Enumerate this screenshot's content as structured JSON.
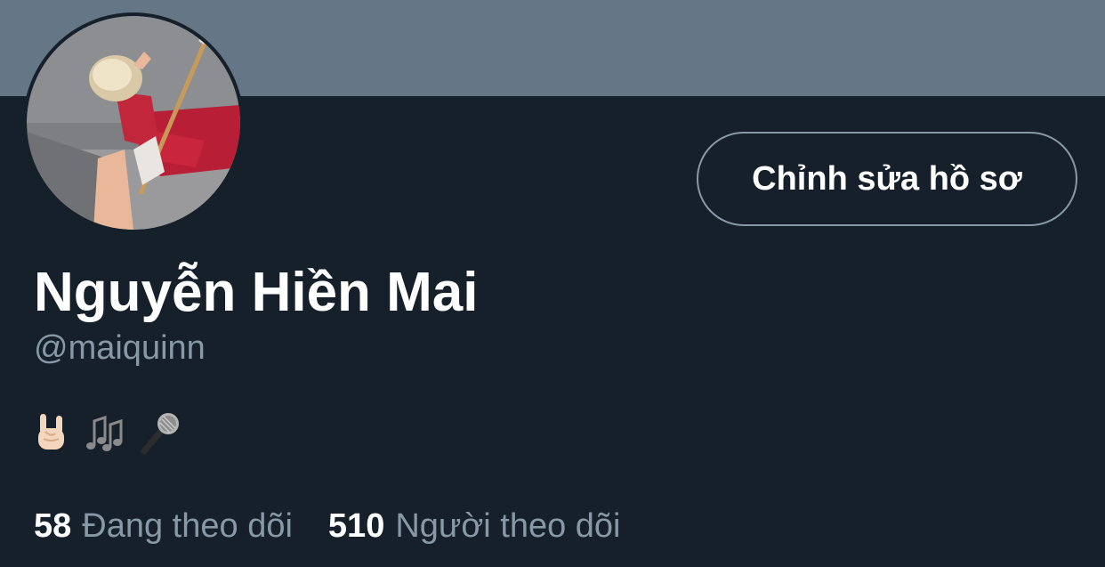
{
  "profile": {
    "display_name": "Nguyễn Hiền Mai",
    "handle": "@maiquinn",
    "bio_icons": [
      "sign-of-the-horns-icon",
      "musical-notes-icon",
      "microphone-icon"
    ],
    "edit_button_label": "Chỉnh sửa hồ sơ"
  },
  "stats": {
    "following_count": "58",
    "following_label": "Đang theo dõi",
    "followers_count": "510",
    "followers_label": "Người theo dõi"
  },
  "colors": {
    "background": "#15202b",
    "banner": "#657786",
    "primary_text": "#ffffff",
    "secondary_text": "#8899a6",
    "button_border": "#8899a6"
  }
}
